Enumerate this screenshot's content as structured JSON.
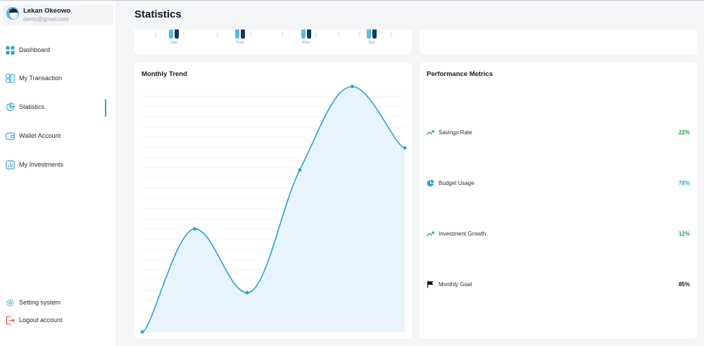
{
  "user": {
    "name": "Lekan Okeowo",
    "email": "demo@gmail.com"
  },
  "nav": {
    "items": [
      {
        "label": "Dashboard",
        "icon": "dashboard-icon"
      },
      {
        "label": "My Transaction",
        "icon": "transaction-icon"
      },
      {
        "label": "Statistics",
        "icon": "pie-chart-icon",
        "active": true
      },
      {
        "label": "Wallet Account",
        "icon": "wallet-icon"
      },
      {
        "label": "My Investments",
        "icon": "investments-icon"
      }
    ],
    "settings_label": "Setting system",
    "logout_label": "Logout account"
  },
  "page": {
    "title": "Statistics"
  },
  "mini_chart": {
    "months": [
      "Jan",
      "Feb",
      "Mar",
      "Apr"
    ]
  },
  "trend": {
    "title": "Monthly Trend"
  },
  "chart_data": {
    "type": "area",
    "title": "Monthly Trend",
    "x": [
      1,
      2,
      3,
      4,
      5,
      6
    ],
    "values": [
      0,
      42,
      16,
      66,
      100,
      75
    ],
    "ylim": [
      0,
      100
    ],
    "grid": true,
    "color": "#2a9fd8",
    "fill": "#e8f4fc"
  },
  "metrics": {
    "title": "Performance Metrics",
    "items": [
      {
        "label": "Savings Rate",
        "value": "22%",
        "icon": "trend-up-icon",
        "color": "#16a34a"
      },
      {
        "label": "Budget Usage",
        "value": "78%",
        "icon": "pie-chart-icon",
        "color": "#2a9fd8"
      },
      {
        "label": "Investment Growth",
        "value": "12%",
        "icon": "trend-up-icon",
        "color": "#16a34a"
      },
      {
        "label": "Monthly Goal",
        "value": "85%",
        "icon": "flag-icon",
        "color": "#0f172a"
      }
    ]
  }
}
